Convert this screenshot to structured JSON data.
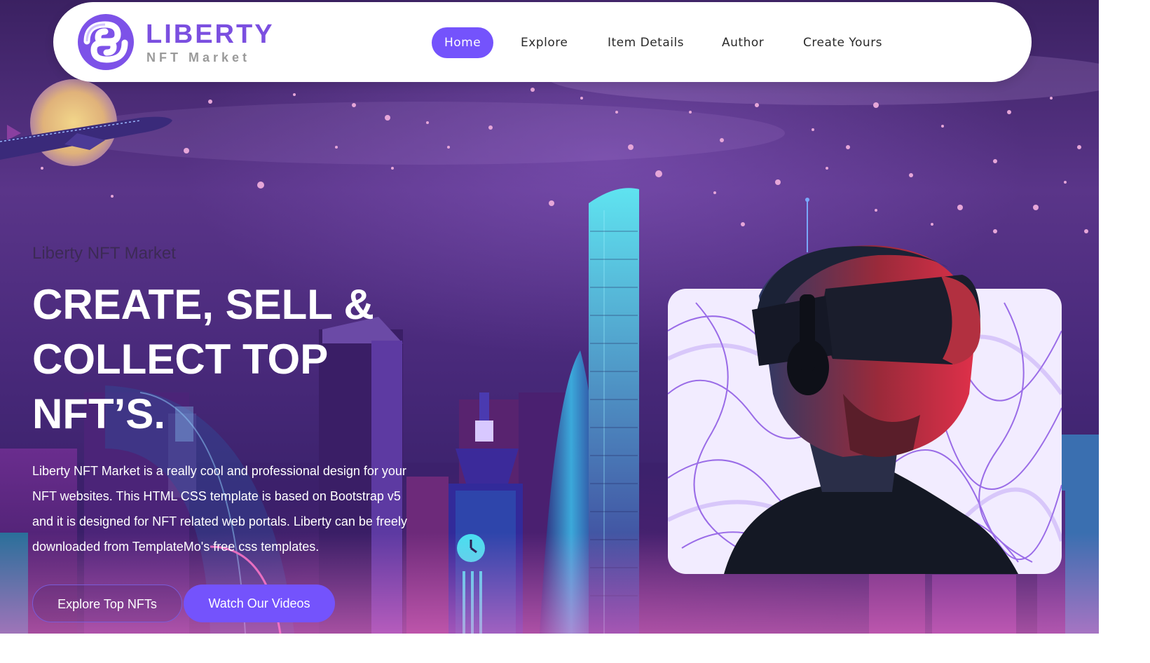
{
  "brand": {
    "name": "LIBERTY",
    "tagline": "NFT Market",
    "accent_color": "#7453fc",
    "logo_icon": "liberty-swirl-logo-icon"
  },
  "nav": {
    "items": [
      {
        "label": "Home",
        "active": true
      },
      {
        "label": "Explore",
        "active": false
      },
      {
        "label": "Item Details",
        "active": false
      },
      {
        "label": "Author",
        "active": false
      },
      {
        "label": "Create Yours",
        "active": false
      }
    ]
  },
  "hero": {
    "eyebrow": "Liberty NFT Market",
    "headline": [
      "CREATE, SELL &",
      "COLLECT TOP",
      "NFT’S."
    ],
    "description": "Liberty NFT Market is a really cool and professional design for your NFT websites. This HTML CSS template is based on Bootstrap v5 and it is designed for NFT related web portals. Liberty can be freely downloaded from TemplateMo's free css templates.",
    "buttons": {
      "primary_label": "Explore Top NFTs",
      "secondary_label": "Watch Our Videos"
    },
    "feature_image": "vr-headset-man-image"
  }
}
